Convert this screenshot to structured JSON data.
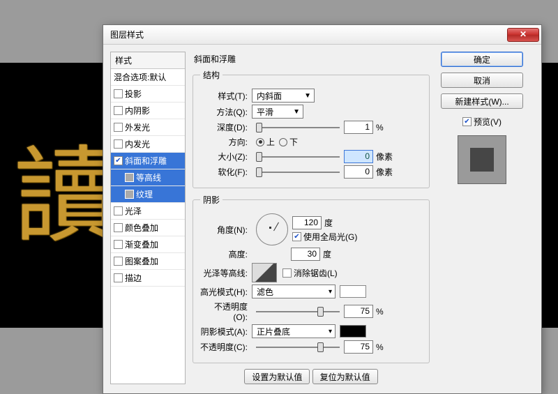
{
  "background_text": "讀",
  "dialog": {
    "title": "图层样式",
    "panel_title": "斜面和浮雕"
  },
  "style_list": {
    "header": "样式",
    "blend_header": "混合选项:默认",
    "items": [
      {
        "label": "投影",
        "checked": false
      },
      {
        "label": "内阴影",
        "checked": false
      },
      {
        "label": "外发光",
        "checked": false
      },
      {
        "label": "内发光",
        "checked": false
      },
      {
        "label": "斜面和浮雕",
        "checked": true,
        "selected": true
      },
      {
        "label": "等高线",
        "sub": true,
        "selected": true
      },
      {
        "label": "纹理",
        "sub": true,
        "selected": true
      },
      {
        "label": "光泽",
        "checked": false
      },
      {
        "label": "颜色叠加",
        "checked": false
      },
      {
        "label": "渐变叠加",
        "checked": false
      },
      {
        "label": "图案叠加",
        "checked": false
      },
      {
        "label": "描边",
        "checked": false
      }
    ]
  },
  "structure": {
    "legend": "结构",
    "style_label": "样式(T):",
    "style_value": "内斜面",
    "technique_label": "方法(Q):",
    "technique_value": "平滑",
    "depth_label": "深度(D):",
    "depth_value": "1",
    "depth_unit": "%",
    "direction_label": "方向:",
    "dir_up": "上",
    "dir_down": "下",
    "size_label": "大小(Z):",
    "size_value": "0",
    "size_unit": "像素",
    "soften_label": "软化(F):",
    "soften_value": "0",
    "soften_unit": "像素"
  },
  "shading": {
    "legend": "阴影",
    "angle_label": "角度(N):",
    "angle_value": "120",
    "degree": "度",
    "global_light": "使用全局光(G)",
    "altitude_label": "高度:",
    "altitude_value": "30",
    "gloss_label": "光泽等高线:",
    "antialias": "消除锯齿(L)",
    "highlight_mode_label": "高光模式(H):",
    "highlight_mode_value": "滤色",
    "hi_opacity_label": "不透明度(O):",
    "hi_opacity_value": "75",
    "shadow_mode_label": "阴影模式(A):",
    "shadow_mode_value": "正片叠底",
    "sh_opacity_label": "不透明度(C):",
    "sh_opacity_value": "75",
    "pct": "%"
  },
  "buttons": {
    "set_default": "设置为默认值",
    "reset_default": "复位为默认值",
    "ok": "确定",
    "cancel": "取消",
    "new_style": "新建样式(W)...",
    "preview": "预览(V)"
  }
}
